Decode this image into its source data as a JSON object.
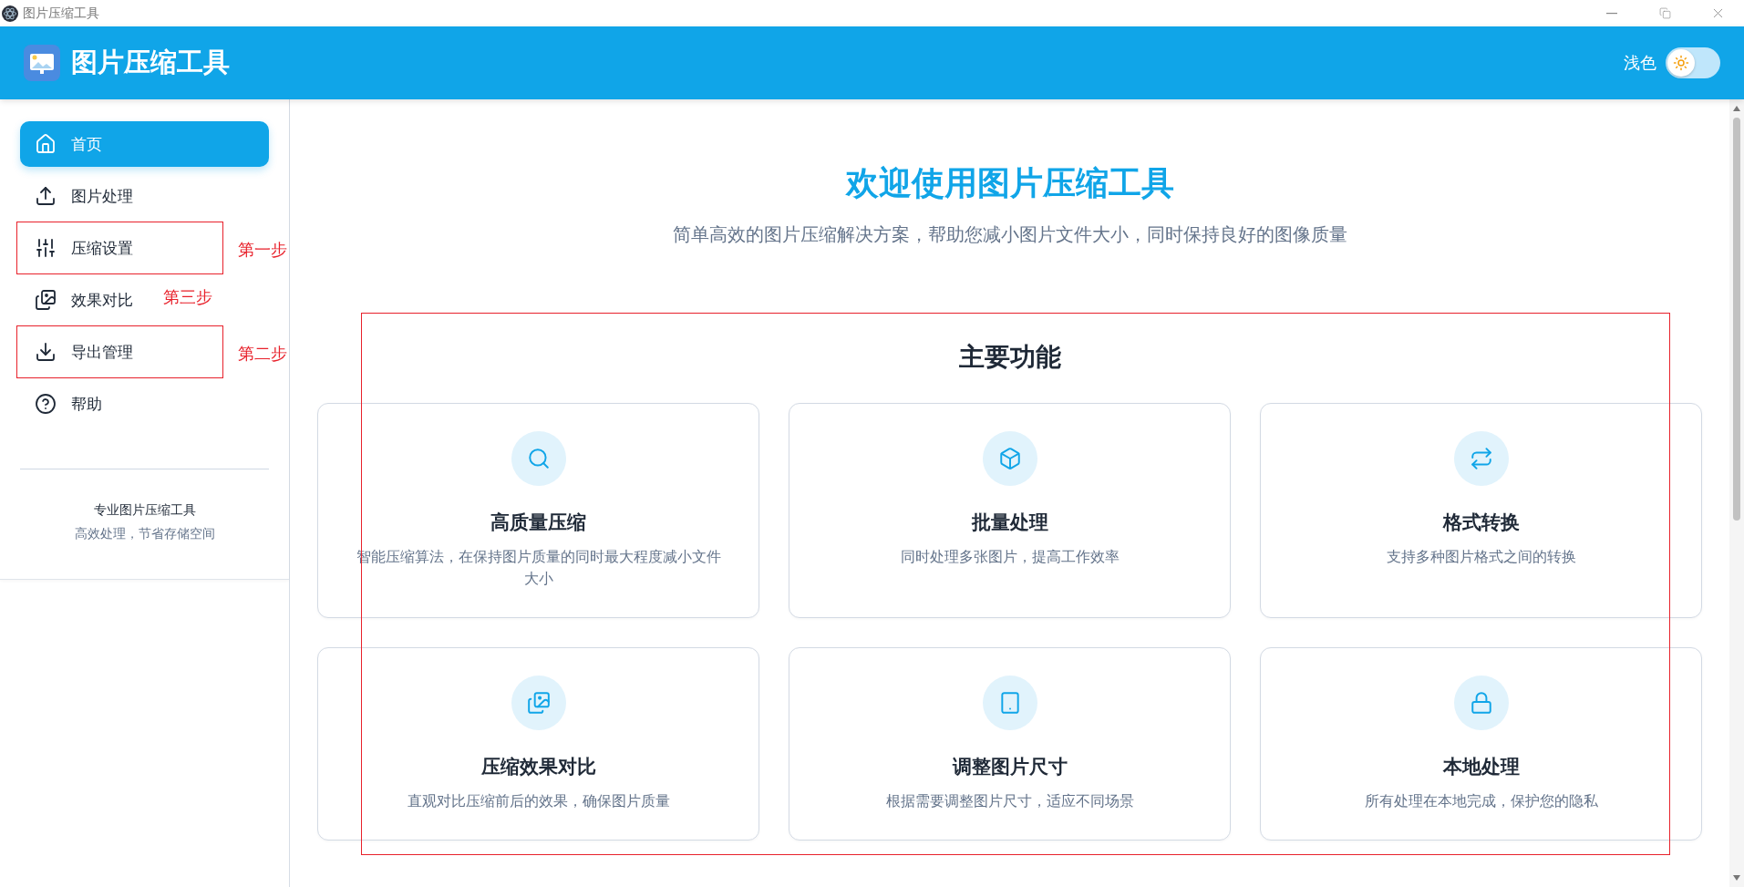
{
  "window": {
    "title": "图片压缩工具"
  },
  "header": {
    "title": "图片压缩工具",
    "theme_label": "浅色",
    "dark": false
  },
  "sidebar": {
    "items": [
      {
        "label": "首页",
        "selected": true,
        "highlighted": false
      },
      {
        "label": "图片处理",
        "selected": false,
        "highlighted": false
      },
      {
        "label": "压缩设置",
        "selected": false,
        "highlighted": true,
        "note": "第一步"
      },
      {
        "label": "效果对比",
        "selected": false,
        "highlighted": false,
        "note": "第三步"
      },
      {
        "label": "导出管理",
        "selected": false,
        "highlighted": true,
        "note": "第二步"
      },
      {
        "label": "帮助",
        "selected": false,
        "highlighted": false
      }
    ],
    "footer_title": "专业图片压缩工具",
    "footer_subtitle": "高效处理，节省存储空间"
  },
  "main": {
    "title": "欢迎使用图片压缩工具",
    "subtitle": "简单高效的图片压缩解决方案，帮助您减小图片文件大小，同时保持良好的图像质量",
    "features": {
      "heading": "主要功能",
      "highlighted": true,
      "cards": [
        {
          "title": "高质量压缩",
          "description": "智能压缩算法，在保持图片质量的同时最大程度减小文件大小"
        },
        {
          "title": "批量处理",
          "description": "同时处理多张图片，提高工作效率"
        },
        {
          "title": "格式转换",
          "description": "支持多种图片格式之间的转换"
        },
        {
          "title": "压缩效果对比",
          "description": "直观对比压缩前后的效果，确保图片质量"
        },
        {
          "title": "调整图片尺寸",
          "description": "根据需要调整图片尺寸，适应不同场景"
        },
        {
          "title": "本地处理",
          "description": "所有处理在本地完成，保护您的隐私"
        }
      ]
    }
  }
}
